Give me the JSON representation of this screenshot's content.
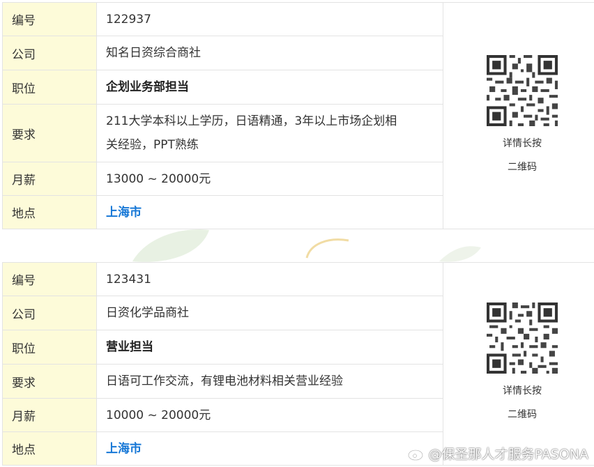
{
  "listings": [
    {
      "rows": [
        {
          "label": "编号",
          "value": "122937"
        },
        {
          "label": "公司",
          "value": "知名日资综合商社"
        },
        {
          "label": "职位",
          "value": "企划业务部担当"
        },
        {
          "label": "要求",
          "value_line1": "211大学本科以上学历，日语精通，3年以上市场企划相",
          "value_line2": "关经验，PPT熟练"
        },
        {
          "label": "月薪",
          "value": "13000 ~ 20000元"
        },
        {
          "label": "地点",
          "value": "上海市"
        }
      ],
      "qr_caption_1": "详情长按",
      "qr_caption_2": "二维码"
    },
    {
      "rows": [
        {
          "label": "编号",
          "value": "123431"
        },
        {
          "label": "公司",
          "value": "日资化学品商社"
        },
        {
          "label": "职位",
          "value": "营业担当"
        },
        {
          "label": "要求",
          "value": "日语可工作交流，有锂电池材料相关营业经验"
        },
        {
          "label": "月薪",
          "value": "10000 ~ 20000元"
        },
        {
          "label": "地点",
          "value": "上海市"
        }
      ],
      "qr_caption_1": "详情长按",
      "qr_caption_2": "二维码"
    }
  ],
  "watermark": "@保圣那人才服务PASONA",
  "colors": {
    "label_bg": "#fdfbd9",
    "city": "#1677d6",
    "border": "#e3e3e3"
  }
}
